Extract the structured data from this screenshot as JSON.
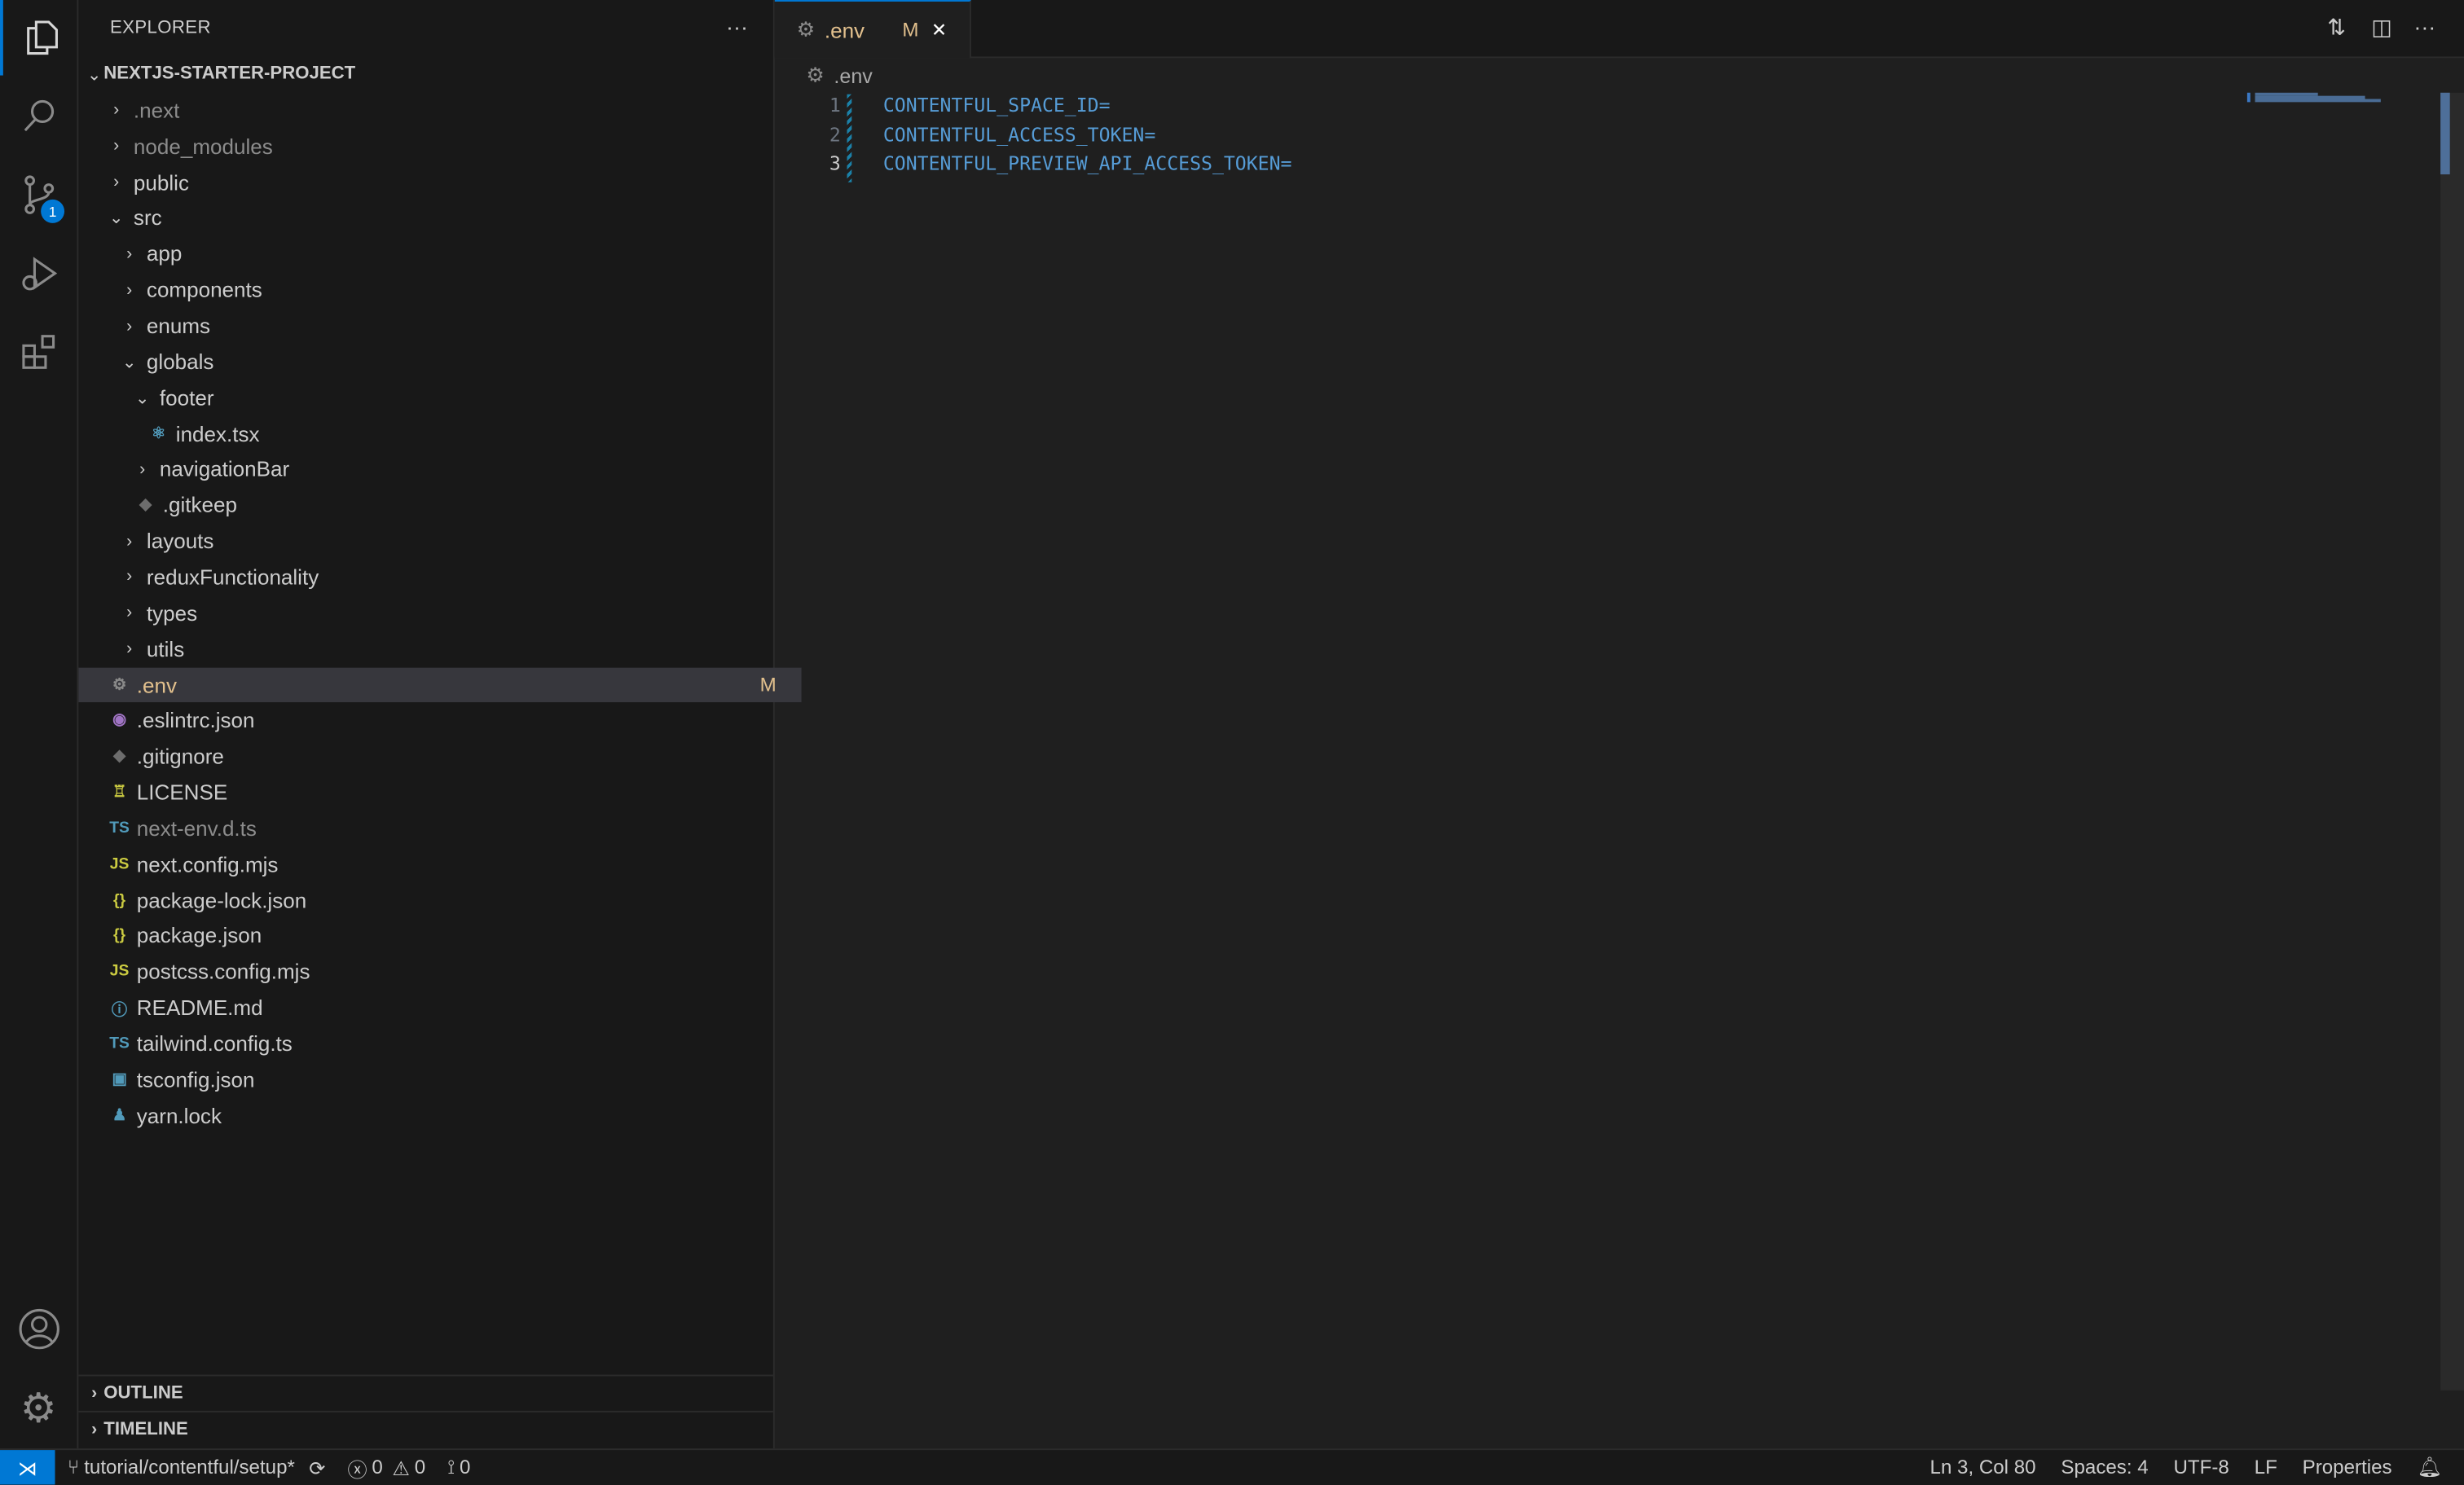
{
  "activity_bar": {
    "items": [
      {
        "name": "explorer",
        "icon": "files-icon",
        "active": true
      },
      {
        "name": "search",
        "icon": "search-icon"
      },
      {
        "name": "source-control",
        "icon": "source-control-icon",
        "badge": "1"
      },
      {
        "name": "run-debug",
        "icon": "run-debug-icon"
      },
      {
        "name": "extensions",
        "icon": "extensions-icon"
      }
    ],
    "bottom": [
      {
        "name": "accounts",
        "icon": "account-icon"
      },
      {
        "name": "manage",
        "icon": "gear-icon"
      }
    ]
  },
  "sidebar": {
    "title": "EXPLORER",
    "more": "···",
    "root": "NEXTJS-STARTER-PROJECT",
    "tree": [
      {
        "label": ".next",
        "depth": 0,
        "type": "folder",
        "dim": true
      },
      {
        "label": "node_modules",
        "depth": 0,
        "type": "folder",
        "dim": true
      },
      {
        "label": "public",
        "depth": 0,
        "type": "folder"
      },
      {
        "label": "src",
        "depth": 0,
        "type": "folder-open"
      },
      {
        "label": "app",
        "depth": 1,
        "type": "folder"
      },
      {
        "label": "components",
        "depth": 1,
        "type": "folder"
      },
      {
        "label": "enums",
        "depth": 1,
        "type": "folder"
      },
      {
        "label": "globals",
        "depth": 1,
        "type": "folder-open"
      },
      {
        "label": "footer",
        "depth": 2,
        "type": "folder-open"
      },
      {
        "label": "index.tsx",
        "depth": 3,
        "type": "file",
        "icon": "react-icon",
        "glyph": "⚛",
        "color": "#519aba"
      },
      {
        "label": "navigationBar",
        "depth": 2,
        "type": "folder"
      },
      {
        "label": ".gitkeep",
        "depth": 2,
        "type": "file",
        "icon": "git-icon",
        "glyph": "◆",
        "color": "#6d6d6d"
      },
      {
        "label": "layouts",
        "depth": 1,
        "type": "folder"
      },
      {
        "label": "reduxFunctionality",
        "depth": 1,
        "type": "folder"
      },
      {
        "label": "types",
        "depth": 1,
        "type": "folder"
      },
      {
        "label": "utils",
        "depth": 1,
        "type": "folder"
      },
      {
        "label": ".env",
        "depth": 0,
        "type": "file",
        "icon": "gear-icon",
        "glyph": "⚙",
        "color": "#8a8a8a",
        "selected": true,
        "modified": "M"
      },
      {
        "label": ".eslintrc.json",
        "depth": 0,
        "type": "file",
        "icon": "eslint-icon",
        "glyph": "◉",
        "color": "#a074c4"
      },
      {
        "label": ".gitignore",
        "depth": 0,
        "type": "file",
        "icon": "git-icon",
        "glyph": "◆",
        "color": "#6d6d6d"
      },
      {
        "label": "LICENSE",
        "depth": 0,
        "type": "file",
        "icon": "license-icon",
        "glyph": "♖",
        "color": "#cbcb41"
      },
      {
        "label": "next-env.d.ts",
        "depth": 0,
        "type": "file",
        "icon": "typescript-icon",
        "glyph": "TS",
        "color": "#519aba",
        "dim": true
      },
      {
        "label": "next.config.mjs",
        "depth": 0,
        "type": "file",
        "icon": "javascript-icon",
        "glyph": "JS",
        "color": "#cbcb41"
      },
      {
        "label": "package-lock.json",
        "depth": 0,
        "type": "file",
        "icon": "json-icon",
        "glyph": "{}",
        "color": "#cbcb41"
      },
      {
        "label": "package.json",
        "depth": 0,
        "type": "file",
        "icon": "json-icon",
        "glyph": "{}",
        "color": "#cbcb41"
      },
      {
        "label": "postcss.config.mjs",
        "depth": 0,
        "type": "file",
        "icon": "javascript-icon",
        "glyph": "JS",
        "color": "#cbcb41"
      },
      {
        "label": "README.md",
        "depth": 0,
        "type": "file",
        "icon": "info-icon",
        "glyph": "ⓘ",
        "color": "#519aba"
      },
      {
        "label": "tailwind.config.ts",
        "depth": 0,
        "type": "file",
        "icon": "typescript-icon",
        "glyph": "TS",
        "color": "#519aba"
      },
      {
        "label": "tsconfig.json",
        "depth": 0,
        "type": "file",
        "icon": "tsconfig-icon",
        "glyph": "▣",
        "color": "#519aba"
      },
      {
        "label": "yarn.lock",
        "depth": 0,
        "type": "file",
        "icon": "yarn-icon",
        "glyph": "♟",
        "color": "#519aba"
      }
    ],
    "panels": [
      "OUTLINE",
      "TIMELINE"
    ]
  },
  "editor": {
    "tab": {
      "label": ".env",
      "modified": "M",
      "close": "✕"
    },
    "breadcrumb": ".env",
    "lines": [
      "CONTENTFUL_SPACE_ID=",
      "CONTENTFUL_ACCESS_TOKEN=",
      "CONTENTFUL_PREVIEW_API_ACCESS_TOKEN="
    ],
    "current_line": 3,
    "actions": [
      "compare-changes-icon",
      "split-editor-icon",
      "more-icon"
    ]
  },
  "status": {
    "branch": "tutorial/contentful/setup*",
    "errors": "0",
    "warnings": "0",
    "ports": "0",
    "position": "Ln 3, Col 80",
    "spaces": "Spaces: 4",
    "encoding": "UTF-8",
    "eol": "LF",
    "language": "Properties"
  },
  "colors": {
    "accent": "#0078d4",
    "modified": "#e2c08d",
    "code": "#569cd6"
  }
}
